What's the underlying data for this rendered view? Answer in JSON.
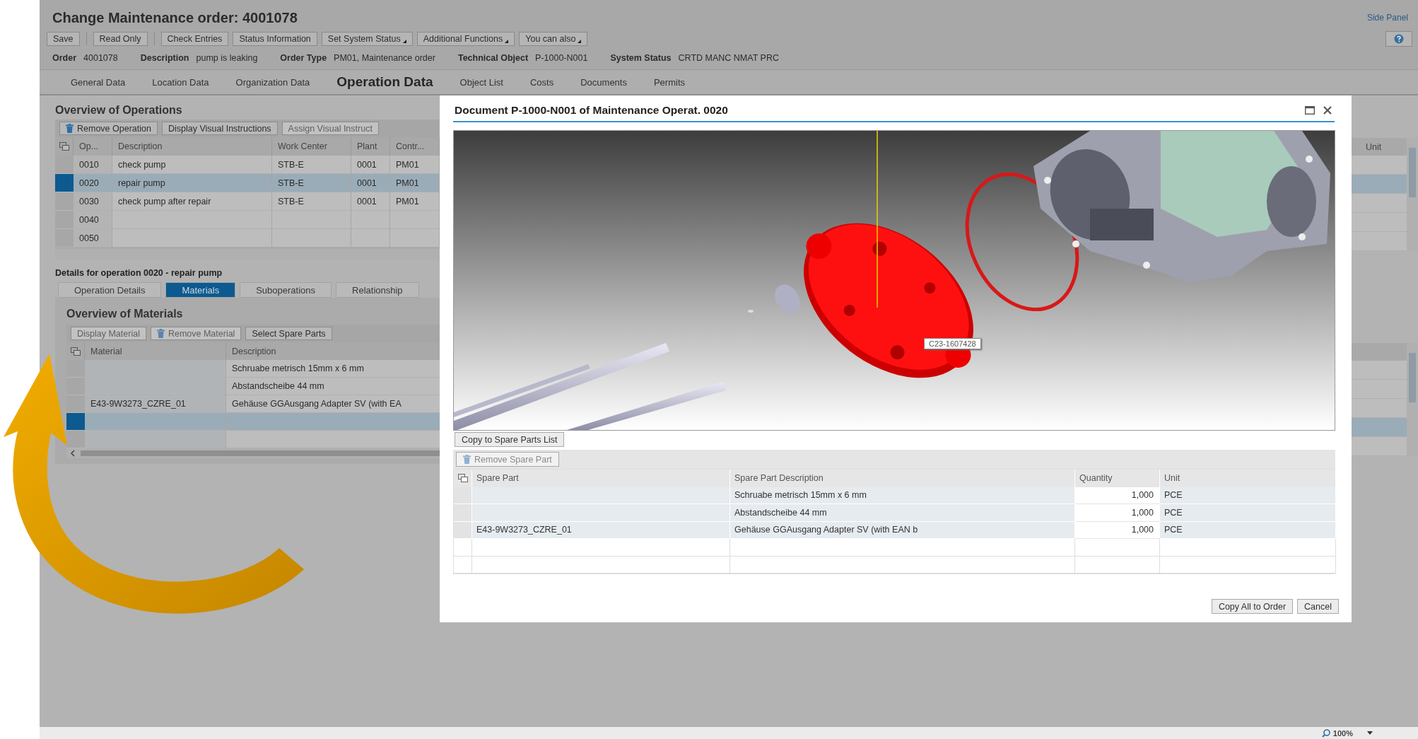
{
  "header": {
    "title": "Change Maintenance order: 4001078",
    "side_panel": "Side Panel"
  },
  "toolbar": [
    {
      "kind": "button",
      "label": "Save",
      "dropdown": false
    },
    {
      "kind": "separator"
    },
    {
      "kind": "button",
      "label": "Read Only",
      "dropdown": false
    },
    {
      "kind": "separator"
    },
    {
      "kind": "button",
      "label": "Check Entries",
      "dropdown": false
    },
    {
      "kind": "button",
      "label": "Status Information",
      "dropdown": false
    },
    {
      "kind": "button",
      "label": "Set System Status",
      "dropdown": true
    },
    {
      "kind": "button",
      "label": "Additional Functions",
      "dropdown": true
    },
    {
      "kind": "button",
      "label": "You can also",
      "dropdown": true
    }
  ],
  "header_fields": [
    {
      "label": "Order",
      "value": "4001078"
    },
    {
      "label": "Description",
      "value": "pump is leaking"
    },
    {
      "label": "Order Type",
      "value": "PM01, Maintenance order"
    },
    {
      "label": "Technical Object",
      "value": "P-1000-N001"
    },
    {
      "label": "System Status",
      "value": "CRTD MANC NMAT PRC"
    }
  ],
  "tabs": [
    {
      "label": "General Data",
      "selected": false
    },
    {
      "label": "Location Data",
      "selected": false
    },
    {
      "label": "Organization Data",
      "selected": false
    },
    {
      "label": "Operation Data",
      "selected": true
    },
    {
      "label": "Object List",
      "selected": false
    },
    {
      "label": "Costs",
      "selected": false
    },
    {
      "label": "Documents",
      "selected": false
    },
    {
      "label": "Permits",
      "selected": false
    }
  ],
  "operations": {
    "title": "Overview of Operations",
    "buttons": [
      {
        "label": "Remove Operation",
        "disabled": false,
        "kind": "trash"
      },
      {
        "label": "Display Visual Instructions",
        "disabled": false,
        "kind": "plain"
      },
      {
        "label": "Assign Visual Instruct",
        "disabled": true,
        "kind": "plain"
      }
    ],
    "columns": [
      "Op...",
      "Description",
      "Work Center",
      "Plant",
      "Contr..."
    ],
    "rows": [
      {
        "op": "0010",
        "description": "check pump",
        "work_center": "STB-E",
        "plant": "0001",
        "control": "PM01",
        "selected": false
      },
      {
        "op": "0020",
        "description": "repair pump",
        "work_center": "STB-E",
        "plant": "0001",
        "control": "PM01",
        "selected": true
      },
      {
        "op": "0030",
        "description": "check pump after repair",
        "work_center": "STB-E",
        "plant": "0001",
        "control": "PM01",
        "selected": false
      },
      {
        "op": "0040",
        "selected": false
      },
      {
        "op": "0050",
        "selected": false
      }
    ]
  },
  "details_title": "Details for operation 0020 - repair pump",
  "detail_tabs": [
    {
      "label": "Operation Details",
      "selected": false
    },
    {
      "label": "Materials",
      "selected": true
    },
    {
      "label": "Suboperations",
      "selected": false
    },
    {
      "label": "Relationship",
      "selected": false
    }
  ],
  "materials": {
    "title": "Overview of Materials",
    "buttons": [
      {
        "label": "Display Material",
        "disabled": true,
        "kind": "plain"
      },
      {
        "label": "Remove Material",
        "disabled": true,
        "kind": "trash"
      },
      {
        "label": "Select Spare Parts",
        "disabled": false,
        "kind": "plain"
      }
    ],
    "columns": [
      "Material",
      "Description"
    ],
    "rows": [
      {
        "description": "Schruabe metrisch 15mm x 6 mm",
        "selected": false
      },
      {
        "description": "Abstandscheibe 44 mm",
        "selected": false
      },
      {
        "material": "E43-9W3273_CZRE_01",
        "description": "Gehäuse GGAusgang Adapter SV (with EA",
        "selected": false
      },
      {
        "selected": true
      },
      {
        "selected": false
      }
    ]
  },
  "right_strip": {
    "column": "Unit"
  },
  "dialog": {
    "title": "Document P-1000-N001 of Maintenance Operat. 0020",
    "viewer_label": "C23-1607428",
    "copy_button": "Copy to Spare Parts List",
    "remove_button": {
      "label": "Remove Spare Part",
      "disabled": true
    },
    "columns": [
      "Spare Part",
      "Spare Part Description",
      "Quantity",
      "Unit"
    ],
    "rows": [
      {
        "description": "Schruabe metrisch 15mm x 6 mm",
        "quantity": "1,000",
        "unit": "PCE"
      },
      {
        "description": "Abstandscheibe 44 mm",
        "quantity": "1,000",
        "unit": "PCE"
      },
      {
        "spare_part": "E43-9W3273_CZRE_01",
        "description": "Gehäuse GGAusgang Adapter SV (with EAN b",
        "quantity": "1,000",
        "unit": "PCE"
      },
      {},
      {}
    ],
    "footer_buttons": [
      "Copy All to Order",
      "Cancel"
    ]
  },
  "status_bar": {
    "zoom": "100%"
  }
}
